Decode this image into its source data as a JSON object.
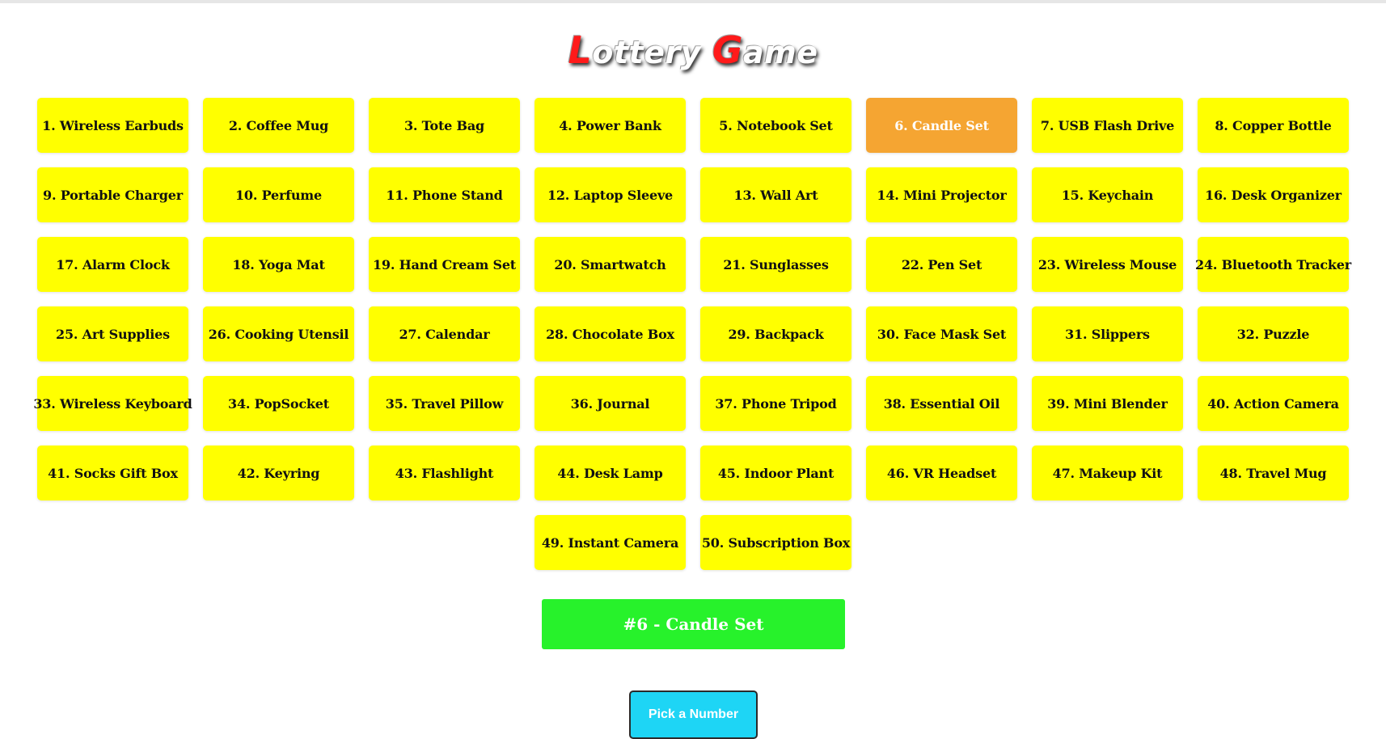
{
  "page": {
    "title_first_cap": "L",
    "title_first_rest": "ottery",
    "title_second_cap": "G",
    "title_second_rest": "ame"
  },
  "colors": {
    "cell": "#ffff00",
    "selected_cell": "#f5a532",
    "result_bar": "#27f22b",
    "pick_button": "#1ed5f5",
    "title_accent": "#ff1a1a"
  },
  "prizes": [
    "1. Wireless Earbuds",
    "2. Coffee Mug",
    "3. Tote Bag",
    "4. Power Bank",
    "5. Notebook Set",
    "6. Candle Set",
    "7. USB Flash Drive",
    "8. Copper Bottle",
    "9. Portable Charger",
    "10. Perfume",
    "11. Phone Stand",
    "12. Laptop Sleeve",
    "13. Wall Art",
    "14. Mini Projector",
    "15. Keychain",
    "16. Desk Organizer",
    "17. Alarm Clock",
    "18. Yoga Mat",
    "19. Hand Cream Set",
    "20. Smartwatch",
    "21. Sunglasses",
    "22. Pen Set",
    "23. Wireless Mouse",
    "24. Bluetooth Tracker",
    "25. Art Supplies",
    "26. Cooking Utensil",
    "27. Calendar",
    "28. Chocolate Box",
    "29. Backpack",
    "30. Face Mask Set",
    "31. Slippers",
    "32. Puzzle",
    "33. Wireless Keyboard",
    "34. PopSocket",
    "35. Travel Pillow",
    "36. Journal",
    "37. Phone Tripod",
    "38. Essential Oil",
    "39. Mini Blender",
    "40. Action Camera",
    "41. Socks Gift Box",
    "42. Keyring",
    "43. Flashlight",
    "44. Desk Lamp",
    "45. Indoor Plant",
    "46. VR Headset",
    "47. Makeup Kit",
    "48. Travel Mug",
    "49. Instant Camera",
    "50. Subscription Box"
  ],
  "selected_number": 6,
  "result": {
    "text": "#6 - Candle Set"
  },
  "controls": {
    "pick_label": "Pick a Number"
  }
}
